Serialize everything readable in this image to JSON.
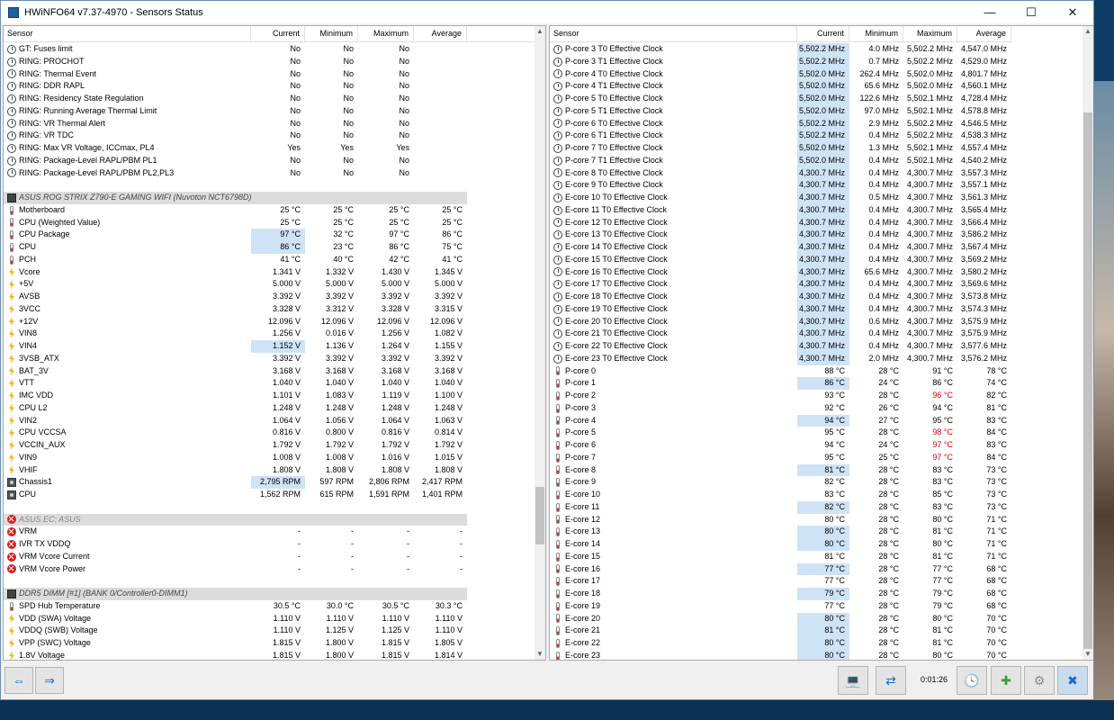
{
  "window": {
    "title": "HWiNFO64 v7.37-4970 - Sensors Status"
  },
  "columns": {
    "sensor": "Sensor",
    "current": "Current",
    "minimum": "Minimum",
    "maximum": "Maximum",
    "average": "Average"
  },
  "left_rows": [
    {
      "i": "clock",
      "n": "GT: Fuses limit",
      "c": "No",
      "mi": "No",
      "ma": "No",
      "a": ""
    },
    {
      "i": "clock",
      "n": "RING: PROCHOT",
      "c": "No",
      "mi": "No",
      "ma": "No",
      "a": ""
    },
    {
      "i": "clock",
      "n": "RING: Thermal Event",
      "c": "No",
      "mi": "No",
      "ma": "No",
      "a": ""
    },
    {
      "i": "clock",
      "n": "RING: DDR RAPL",
      "c": "No",
      "mi": "No",
      "ma": "No",
      "a": ""
    },
    {
      "i": "clock",
      "n": "RING: Residency State Regulation",
      "c": "No",
      "mi": "No",
      "ma": "No",
      "a": ""
    },
    {
      "i": "clock",
      "n": "RING: Running Average Thermal Limit",
      "c": "No",
      "mi": "No",
      "ma": "No",
      "a": ""
    },
    {
      "i": "clock",
      "n": "RING: VR Thermal Alert",
      "c": "No",
      "mi": "No",
      "ma": "No",
      "a": ""
    },
    {
      "i": "clock",
      "n": "RING: VR TDC",
      "c": "No",
      "mi": "No",
      "ma": "No",
      "a": ""
    },
    {
      "i": "clock",
      "n": "RING: Max VR Voltage, ICCmax, PL4",
      "c": "Yes",
      "mi": "Yes",
      "ma": "Yes",
      "a": ""
    },
    {
      "i": "clock",
      "n": "RING: Package-Level RAPL/PBM PL1",
      "c": "No",
      "mi": "No",
      "ma": "No",
      "a": ""
    },
    {
      "i": "clock",
      "n": "RING: Package-Level RAPL/PBM PL2,PL3",
      "c": "No",
      "mi": "No",
      "ma": "No",
      "a": ""
    },
    {
      "blank": true
    },
    {
      "grp": true,
      "i": "chip",
      "n": "ASUS ROG STRIX Z790-E GAMING WIFI (Nuvoton NCT6798D)"
    },
    {
      "i": "temp",
      "n": "Motherboard",
      "c": "25 °C",
      "mi": "25 °C",
      "ma": "25 °C",
      "a": "25 °C"
    },
    {
      "i": "temp",
      "n": "CPU (Weighted Value)",
      "c": "25 °C",
      "mi": "25 °C",
      "ma": "25 °C",
      "a": "25 °C"
    },
    {
      "i": "temp",
      "n": "CPU Package",
      "c": "97 °C",
      "mi": "32 °C",
      "ma": "97 °C",
      "a": "86 °C",
      "hl": true
    },
    {
      "i": "temp",
      "n": "CPU",
      "c": "86 °C",
      "mi": "23 °C",
      "ma": "86 °C",
      "a": "75 °C",
      "hl": true
    },
    {
      "i": "temp",
      "n": "PCH",
      "c": "41 °C",
      "mi": "40 °C",
      "ma": "42 °C",
      "a": "41 °C"
    },
    {
      "i": "volt",
      "n": "Vcore",
      "c": "1.341 V",
      "mi": "1.332 V",
      "ma": "1.430 V",
      "a": "1.345 V"
    },
    {
      "i": "volt",
      "n": "+5V",
      "c": "5.000 V",
      "mi": "5.000 V",
      "ma": "5.000 V",
      "a": "5.000 V"
    },
    {
      "i": "volt",
      "n": "AVSB",
      "c": "3.392 V",
      "mi": "3.392 V",
      "ma": "3.392 V",
      "a": "3.392 V"
    },
    {
      "i": "volt",
      "n": "3VCC",
      "c": "3.328 V",
      "mi": "3.312 V",
      "ma": "3.328 V",
      "a": "3.315 V"
    },
    {
      "i": "volt",
      "n": "+12V",
      "c": "12.096 V",
      "mi": "12.096 V",
      "ma": "12.096 V",
      "a": "12.096 V"
    },
    {
      "i": "volt",
      "n": "VIN8",
      "c": "1.256 V",
      "mi": "0.016 V",
      "ma": "1.256 V",
      "a": "1.082 V"
    },
    {
      "i": "volt",
      "n": "VIN4",
      "c": "1.152 V",
      "mi": "1.136 V",
      "ma": "1.264 V",
      "a": "1.155 V",
      "hl": true
    },
    {
      "i": "volt",
      "n": "3VSB_ATX",
      "c": "3.392 V",
      "mi": "3.392 V",
      "ma": "3.392 V",
      "a": "3.392 V"
    },
    {
      "i": "volt",
      "n": "BAT_3V",
      "c": "3.168 V",
      "mi": "3.168 V",
      "ma": "3.168 V",
      "a": "3.168 V"
    },
    {
      "i": "volt",
      "n": "VTT",
      "c": "1.040 V",
      "mi": "1.040 V",
      "ma": "1.040 V",
      "a": "1.040 V"
    },
    {
      "i": "volt",
      "n": "IMC VDD",
      "c": "1.101 V",
      "mi": "1.083 V",
      "ma": "1.119 V",
      "a": "1.100 V"
    },
    {
      "i": "volt",
      "n": "CPU L2",
      "c": "1.248 V",
      "mi": "1.248 V",
      "ma": "1.248 V",
      "a": "1.248 V"
    },
    {
      "i": "volt",
      "n": "VIN2",
      "c": "1.064 V",
      "mi": "1.056 V",
      "ma": "1.064 V",
      "a": "1.063 V"
    },
    {
      "i": "volt",
      "n": "CPU VCCSA",
      "c": "0.816 V",
      "mi": "0.800 V",
      "ma": "0.816 V",
      "a": "0.814 V"
    },
    {
      "i": "volt",
      "n": "VCCIN_AUX",
      "c": "1.792 V",
      "mi": "1.792 V",
      "ma": "1.792 V",
      "a": "1.792 V"
    },
    {
      "i": "volt",
      "n": "VIN9",
      "c": "1.008 V",
      "mi": "1.008 V",
      "ma": "1.016 V",
      "a": "1.015 V"
    },
    {
      "i": "volt",
      "n": "VHIF",
      "c": "1.808 V",
      "mi": "1.808 V",
      "ma": "1.808 V",
      "a": "1.808 V"
    },
    {
      "i": "fan",
      "n": "Chassis1",
      "c": "2,795 RPM",
      "mi": "597 RPM",
      "ma": "2,806 RPM",
      "a": "2,417 RPM",
      "hl": true
    },
    {
      "i": "fan",
      "n": "CPU",
      "c": "1,562 RPM",
      "mi": "615 RPM",
      "ma": "1,591 RPM",
      "a": "1,401 RPM"
    },
    {
      "blank": true
    },
    {
      "grp": true,
      "dis": true,
      "i": "err",
      "n": "ASUS EC: ASUS"
    },
    {
      "i": "err",
      "n": "VRM",
      "c": "-",
      "mi": "-",
      "ma": "-",
      "a": "-"
    },
    {
      "i": "err",
      "n": "IVR TX VDDQ",
      "c": "-",
      "mi": "-",
      "ma": "-",
      "a": "-"
    },
    {
      "i": "err",
      "n": "VRM Vcore Current",
      "c": "-",
      "mi": "-",
      "ma": "-",
      "a": "-"
    },
    {
      "i": "err",
      "n": "VRM Vcore Power",
      "c": "-",
      "mi": "-",
      "ma": "-",
      "a": "-"
    },
    {
      "blank": true
    },
    {
      "grp": true,
      "i": "chip",
      "n": "DDR5 DIMM [#1] (BANK 0/Controller0-DIMM1)"
    },
    {
      "i": "temp",
      "n": "SPD Hub Temperature",
      "c": "30.5 °C",
      "mi": "30.0 °C",
      "ma": "30.5 °C",
      "a": "30.3 °C"
    },
    {
      "i": "volt",
      "n": "VDD (SWA) Voltage",
      "c": "1.110 V",
      "mi": "1.110 V",
      "ma": "1.110 V",
      "a": "1.110 V"
    },
    {
      "i": "volt",
      "n": "VDDQ (SWB) Voltage",
      "c": "1.110 V",
      "mi": "1.125 V",
      "ma": "1.125 V",
      "a": "1.110 V"
    },
    {
      "i": "volt",
      "n": "VPP (SWC) Voltage",
      "c": "1.815 V",
      "mi": "1.800 V",
      "ma": "1.815 V",
      "a": "1.805 V"
    },
    {
      "i": "volt",
      "n": "1.8V Voltage",
      "c": "1.815 V",
      "mi": "1.800 V",
      "ma": "1.815 V",
      "a": "1.814 V"
    }
  ],
  "right_rows": [
    {
      "i": "clock",
      "n": "P-core 3 T0 Effective Clock",
      "c": "5,502.2 MHz",
      "mi": "4.0 MHz",
      "ma": "5,502.2 MHz",
      "a": "4,547.0 MHz",
      "hl": true
    },
    {
      "i": "clock",
      "n": "P-core 3 T1 Effective Clock",
      "c": "5,502.2 MHz",
      "mi": "0.7 MHz",
      "ma": "5,502.2 MHz",
      "a": "4,529.0 MHz",
      "hl": true
    },
    {
      "i": "clock",
      "n": "P-core 4 T0 Effective Clock",
      "c": "5,502.0 MHz",
      "mi": "262.4 MHz",
      "ma": "5,502.0 MHz",
      "a": "4,801.7 MHz",
      "hl": true
    },
    {
      "i": "clock",
      "n": "P-core 4 T1 Effective Clock",
      "c": "5,502.0 MHz",
      "mi": "65.6 MHz",
      "ma": "5,502.0 MHz",
      "a": "4,560.1 MHz",
      "hl": true
    },
    {
      "i": "clock",
      "n": "P-core 5 T0 Effective Clock",
      "c": "5,502.0 MHz",
      "mi": "122.6 MHz",
      "ma": "5,502.1 MHz",
      "a": "4,728.4 MHz",
      "hl": true
    },
    {
      "i": "clock",
      "n": "P-core 5 T1 Effective Clock",
      "c": "5,502.0 MHz",
      "mi": "97.0 MHz",
      "ma": "5,502.1 MHz",
      "a": "4,578.8 MHz",
      "hl": true
    },
    {
      "i": "clock",
      "n": "P-core 6 T0 Effective Clock",
      "c": "5,502.2 MHz",
      "mi": "2.9 MHz",
      "ma": "5,502.2 MHz",
      "a": "4,546.5 MHz",
      "hl": true
    },
    {
      "i": "clock",
      "n": "P-core 6 T1 Effective Clock",
      "c": "5,502.2 MHz",
      "mi": "0.4 MHz",
      "ma": "5,502.2 MHz",
      "a": "4,538.3 MHz",
      "hl": true
    },
    {
      "i": "clock",
      "n": "P-core 7 T0 Effective Clock",
      "c": "5,502.0 MHz",
      "mi": "1.3 MHz",
      "ma": "5,502.1 MHz",
      "a": "4,557.4 MHz",
      "hl": true
    },
    {
      "i": "clock",
      "n": "P-core 7 T1 Effective Clock",
      "c": "5,502.0 MHz",
      "mi": "0.4 MHz",
      "ma": "5,502.1 MHz",
      "a": "4,540.2 MHz",
      "hl": true
    },
    {
      "i": "clock",
      "n": "E-core 8 T0 Effective Clock",
      "c": "4,300.7 MHz",
      "mi": "0.4 MHz",
      "ma": "4,300.7 MHz",
      "a": "3,557.3 MHz",
      "hl": true
    },
    {
      "i": "clock",
      "n": "E-core 9 T0 Effective Clock",
      "c": "4,300.7 MHz",
      "mi": "0.4 MHz",
      "ma": "4,300.7 MHz",
      "a": "3,557.1 MHz",
      "hl": true
    },
    {
      "i": "clock",
      "n": "E-core 10 T0 Effective Clock",
      "c": "4,300.7 MHz",
      "mi": "0.5 MHz",
      "ma": "4,300.7 MHz",
      "a": "3,561.3 MHz",
      "hl": true
    },
    {
      "i": "clock",
      "n": "E-core 11 T0 Effective Clock",
      "c": "4,300.7 MHz",
      "mi": "0.4 MHz",
      "ma": "4,300.7 MHz",
      "a": "3,565.4 MHz",
      "hl": true
    },
    {
      "i": "clock",
      "n": "E-core 12 T0 Effective Clock",
      "c": "4,300.7 MHz",
      "mi": "0.4 MHz",
      "ma": "4,300.7 MHz",
      "a": "3,566.4 MHz",
      "hl": true
    },
    {
      "i": "clock",
      "n": "E-core 13 T0 Effective Clock",
      "c": "4,300.7 MHz",
      "mi": "0.4 MHz",
      "ma": "4,300.7 MHz",
      "a": "3,586.2 MHz",
      "hl": true
    },
    {
      "i": "clock",
      "n": "E-core 14 T0 Effective Clock",
      "c": "4,300.7 MHz",
      "mi": "0.4 MHz",
      "ma": "4,300.7 MHz",
      "a": "3,567.4 MHz",
      "hl": true
    },
    {
      "i": "clock",
      "n": "E-core 15 T0 Effective Clock",
      "c": "4,300.7 MHz",
      "mi": "0.4 MHz",
      "ma": "4,300.7 MHz",
      "a": "3,569.2 MHz",
      "hl": true
    },
    {
      "i": "clock",
      "n": "E-core 16 T0 Effective Clock",
      "c": "4,300.7 MHz",
      "mi": "65.6 MHz",
      "ma": "4,300.7 MHz",
      "a": "3,580.2 MHz",
      "hl": true
    },
    {
      "i": "clock",
      "n": "E-core 17 T0 Effective Clock",
      "c": "4,300.7 MHz",
      "mi": "0.4 MHz",
      "ma": "4,300.7 MHz",
      "a": "3,569.6 MHz",
      "hl": true
    },
    {
      "i": "clock",
      "n": "E-core 18 T0 Effective Clock",
      "c": "4,300.7 MHz",
      "mi": "0.4 MHz",
      "ma": "4,300.7 MHz",
      "a": "3,573.8 MHz",
      "hl": true
    },
    {
      "i": "clock",
      "n": "E-core 19 T0 Effective Clock",
      "c": "4,300.7 MHz",
      "mi": "0.4 MHz",
      "ma": "4,300.7 MHz",
      "a": "3,574.3 MHz",
      "hl": true
    },
    {
      "i": "clock",
      "n": "E-core 20 T0 Effective Clock",
      "c": "4,300.7 MHz",
      "mi": "0.6 MHz",
      "ma": "4,300.7 MHz",
      "a": "3,575.9 MHz",
      "hl": true
    },
    {
      "i": "clock",
      "n": "E-core 21 T0 Effective Clock",
      "c": "4,300.7 MHz",
      "mi": "0.4 MHz",
      "ma": "4,300.7 MHz",
      "a": "3,575.9 MHz",
      "hl": true
    },
    {
      "i": "clock",
      "n": "E-core 22 T0 Effective Clock",
      "c": "4,300.7 MHz",
      "mi": "0.4 MHz",
      "ma": "4,300.7 MHz",
      "a": "3,577.6 MHz",
      "hl": true
    },
    {
      "i": "clock",
      "n": "E-core 23 T0 Effective Clock",
      "c": "4,300.7 MHz",
      "mi": "2.0 MHz",
      "ma": "4,300.7 MHz",
      "a": "3,576.2 MHz",
      "hl": true
    },
    {
      "i": "temp",
      "n": "P-core 0",
      "c": "88 °C",
      "mi": "28 °C",
      "ma": "91 °C",
      "a": "78 °C"
    },
    {
      "i": "temp",
      "n": "P-core 1",
      "c": "86 °C",
      "mi": "24 °C",
      "ma": "86 °C",
      "a": "74 °C",
      "hl": true
    },
    {
      "i": "temp",
      "n": "P-core 2",
      "c": "93 °C",
      "mi": "28 °C",
      "ma": "96 °C",
      "a": "82 °C",
      "red": true
    },
    {
      "i": "temp",
      "n": "P-core 3",
      "c": "92 °C",
      "mi": "26 °C",
      "ma": "94 °C",
      "a": "81 °C"
    },
    {
      "i": "temp",
      "n": "P-core 4",
      "c": "94 °C",
      "mi": "27 °C",
      "ma": "95 °C",
      "a": "83 °C",
      "hl": true
    },
    {
      "i": "temp",
      "n": "P-core 5",
      "c": "95 °C",
      "mi": "28 °C",
      "ma": "98 °C",
      "a": "84 °C",
      "red": true
    },
    {
      "i": "temp",
      "n": "P-core 6",
      "c": "94 °C",
      "mi": "24 °C",
      "ma": "97 °C",
      "a": "83 °C",
      "red": true
    },
    {
      "i": "temp",
      "n": "P-core 7",
      "c": "95 °C",
      "mi": "25 °C",
      "ma": "97 °C",
      "a": "84 °C",
      "red": true
    },
    {
      "i": "temp",
      "n": "E-core 8",
      "c": "81 °C",
      "mi": "28 °C",
      "ma": "83 °C",
      "a": "73 °C",
      "hl": true
    },
    {
      "i": "temp",
      "n": "E-core 9",
      "c": "82 °C",
      "mi": "28 °C",
      "ma": "83 °C",
      "a": "73 °C"
    },
    {
      "i": "temp",
      "n": "E-core 10",
      "c": "83 °C",
      "mi": "28 °C",
      "ma": "85 °C",
      "a": "73 °C"
    },
    {
      "i": "temp",
      "n": "E-core 11",
      "c": "82 °C",
      "mi": "28 °C",
      "ma": "83 °C",
      "a": "73 °C",
      "hl": true
    },
    {
      "i": "temp",
      "n": "E-core 12",
      "c": "80 °C",
      "mi": "28 °C",
      "ma": "80 °C",
      "a": "71 °C"
    },
    {
      "i": "temp",
      "n": "E-core 13",
      "c": "80 °C",
      "mi": "28 °C",
      "ma": "81 °C",
      "a": "71 °C",
      "hl": true
    },
    {
      "i": "temp",
      "n": "E-core 14",
      "c": "80 °C",
      "mi": "28 °C",
      "ma": "80 °C",
      "a": "71 °C",
      "hl": true
    },
    {
      "i": "temp",
      "n": "E-core 15",
      "c": "81 °C",
      "mi": "28 °C",
      "ma": "81 °C",
      "a": "71 °C"
    },
    {
      "i": "temp",
      "n": "E-core 16",
      "c": "77 °C",
      "mi": "28 °C",
      "ma": "77 °C",
      "a": "68 °C",
      "hl": true
    },
    {
      "i": "temp",
      "n": "E-core 17",
      "c": "77 °C",
      "mi": "28 °C",
      "ma": "77 °C",
      "a": "68 °C"
    },
    {
      "i": "temp",
      "n": "E-core 18",
      "c": "79 °C",
      "mi": "28 °C",
      "ma": "79 °C",
      "a": "68 °C",
      "hl": true
    },
    {
      "i": "temp",
      "n": "E-core 19",
      "c": "77 °C",
      "mi": "28 °C",
      "ma": "79 °C",
      "a": "68 °C"
    },
    {
      "i": "temp",
      "n": "E-core 20",
      "c": "80 °C",
      "mi": "28 °C",
      "ma": "80 °C",
      "a": "70 °C",
      "hl": true
    },
    {
      "i": "temp",
      "n": "E-core 21",
      "c": "81 °C",
      "mi": "28 °C",
      "ma": "81 °C",
      "a": "70 °C",
      "hl": true
    },
    {
      "i": "temp",
      "n": "E-core 22",
      "c": "80 °C",
      "mi": "28 °C",
      "ma": "81 °C",
      "a": "70 °C",
      "hl": true
    },
    {
      "i": "temp",
      "n": "E-core 23",
      "c": "80 °C",
      "mi": "28 °C",
      "ma": "80 °C",
      "a": "70 °C",
      "hl": true
    }
  ],
  "toolbar": {
    "timer": "0:01:26"
  },
  "colors": {
    "highlight": "#cfe3f7",
    "alert_red": "#d40000",
    "group_band": "#dcdcdc"
  }
}
